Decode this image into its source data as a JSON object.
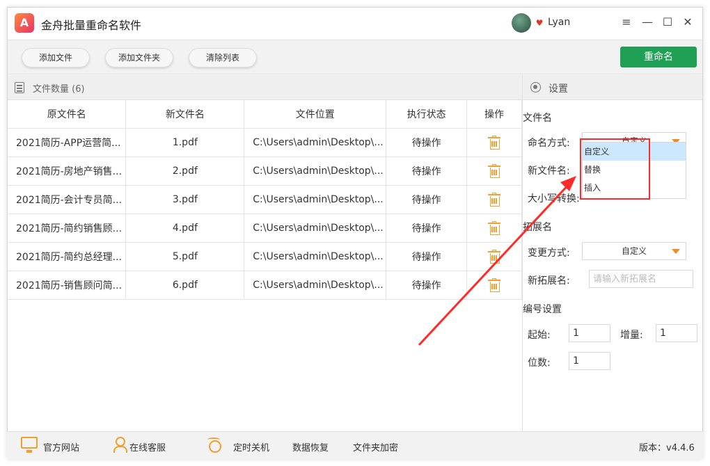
{
  "app": {
    "logo_text": "A",
    "title": "金舟批量重命名软件",
    "user": "Lyan",
    "vip_symbol": "♥"
  },
  "window_controls": {
    "menu": "≡",
    "minimize": "—",
    "maximize": "☐",
    "close": "✕"
  },
  "toolbar": {
    "add_file": "添加文件",
    "add_folder": "添加文件夹",
    "clear_list": "清除列表",
    "rename": "重命名"
  },
  "file_panel": {
    "count_label": "文件数量 (6)",
    "columns": [
      "原文件名",
      "新文件名",
      "文件位置",
      "执行状态",
      "操作"
    ],
    "rows": [
      {
        "original": "2021简历-APP运营简...",
        "new": "1.pdf",
        "location": "C:\\Users\\admin\\Desktop\\...",
        "status": "待操作"
      },
      {
        "original": "2021简历-房地产销售...",
        "new": "2.pdf",
        "location": "C:\\Users\\admin\\Desktop\\...",
        "status": "待操作"
      },
      {
        "original": "2021简历-会计专员简...",
        "new": "3.pdf",
        "location": "C:\\Users\\admin\\Desktop\\...",
        "status": "待操作"
      },
      {
        "original": "2021简历-简约销售顾...",
        "new": "4.pdf",
        "location": "C:\\Users\\admin\\Desktop\\...",
        "status": "待操作"
      },
      {
        "original": "2021简历-简约总经理...",
        "new": "5.pdf",
        "location": "C:\\Users\\admin\\Desktop\\...",
        "status": "待操作"
      },
      {
        "original": "2021简历-销售顾问简...",
        "new": "6.pdf",
        "location": "C:\\Users\\admin\\Desktop\\...",
        "status": "待操作"
      }
    ]
  },
  "settings": {
    "title": "设置",
    "filename_section": "文件名",
    "naming_mode_label": "命名方式:",
    "naming_mode_value": "自定义",
    "naming_options": [
      "自定义",
      "替换",
      "插入"
    ],
    "new_filename_label": "新文件名:",
    "case_label": "大小写转换:",
    "extension_section": "拓展名",
    "change_mode_label": "变更方式:",
    "change_mode_value": "自定义",
    "new_extension_label": "新拓展名:",
    "new_extension_placeholder": "请输入新拓展名",
    "numbering_section": "编号设置",
    "start_label": "起始:",
    "start_value": "1",
    "increment_label": "增量:",
    "increment_value": "1",
    "digits_label": "位数:",
    "digits_value": "1"
  },
  "footer": {
    "website": "官方网站",
    "support": "在线客服",
    "shutdown": "定时关机",
    "recovery": "数据恢复",
    "encrypt": "文件夹加密",
    "version": "版本：v4.4.6"
  },
  "colors": {
    "primary_green": "#1fa055",
    "accent_orange": "#f0a030",
    "annotation_red": "#ff2a2a",
    "dropdown_highlight": "#cce8ff"
  }
}
